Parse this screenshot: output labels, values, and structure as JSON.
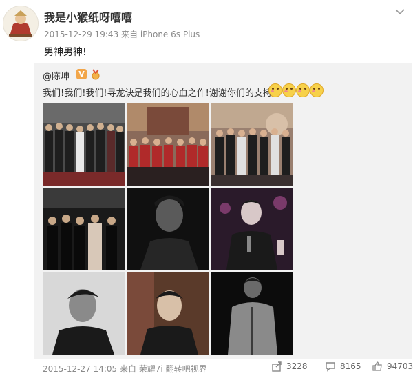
{
  "post": {
    "username": "我是小猴纸呀嘻嘻",
    "date": "2015-12-29 19:43",
    "source_prefix": "来自",
    "device": "iPhone 6s Plus",
    "text": "男神男神!"
  },
  "repost": {
    "author": "@陈坤",
    "verified_label": "V",
    "text": "我们!我们!我们!寻龙诀是我们的心血之作!谢谢你们的支持!",
    "emoji_count": 4,
    "photos": [
      {
        "name": "cast-lineup"
      },
      {
        "name": "cast-red-jackets"
      },
      {
        "name": "cast-stage"
      },
      {
        "name": "premiere-red-carpet"
      },
      {
        "name": "portrait-dark"
      },
      {
        "name": "mic-speech"
      },
      {
        "name": "closeup-left"
      },
      {
        "name": "closeup-poster"
      },
      {
        "name": "denim-jacket"
      }
    ],
    "footer": {
      "date": "2015-12-27 14:05",
      "source": "来自 荣耀7i 翻转吧视界",
      "reposts": "3228",
      "comments": "8165",
      "likes": "94703"
    }
  },
  "colors": {
    "accent": "#eb7350",
    "repost_bg": "#f2f2f2",
    "meta": "#8a8a8a"
  }
}
